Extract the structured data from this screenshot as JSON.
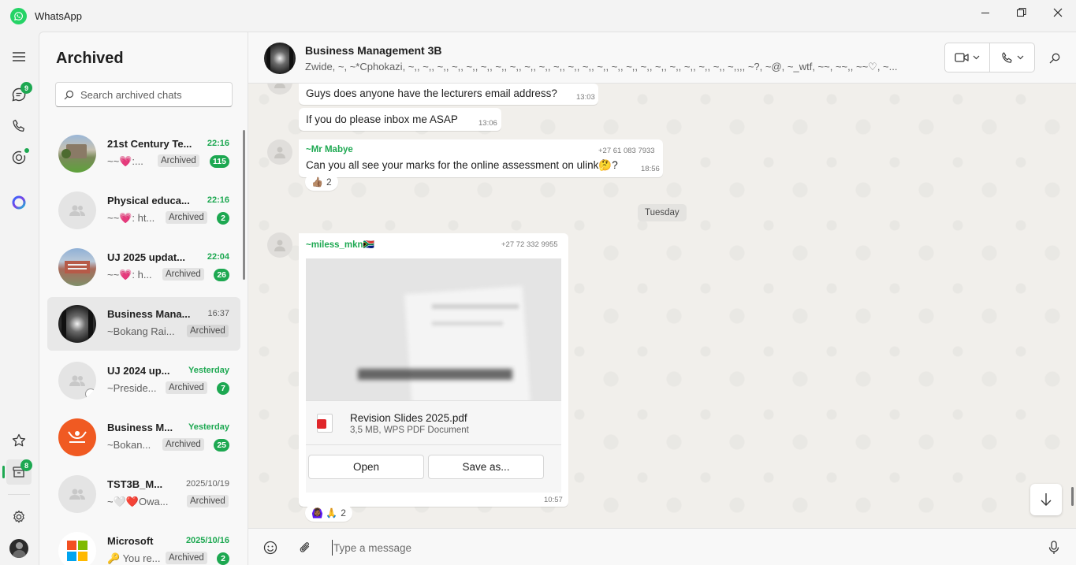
{
  "app": {
    "title": "WhatsApp"
  },
  "rail": {
    "chats_badge": "9",
    "archived_badge": "8"
  },
  "list": {
    "title": "Archived",
    "search_placeholder": "Search archived chats",
    "archived_label": "Archived",
    "chats": [
      {
        "name": "21st Century Te...",
        "time": "22:16",
        "preview": "~~💗:...",
        "count": "115",
        "unread": true,
        "avatar": "photo-campus"
      },
      {
        "name": "Physical educa...",
        "time": "22:16",
        "preview": "~~💗: ht...",
        "count": "2",
        "unread": true,
        "avatar": "group"
      },
      {
        "name": "UJ 2025 updat...",
        "time": "22:04",
        "preview": "~~💗: h...",
        "count": "26",
        "unread": true,
        "avatar": "photo-building"
      },
      {
        "name": "Business Mana...",
        "time": "16:37",
        "preview": "~Bokang Rai...",
        "count": "",
        "unread": false,
        "avatar": "photo-dark"
      },
      {
        "name": "UJ 2024 up...",
        "time": "Yesterday",
        "preview": "~Preside...",
        "count": "7",
        "unread": true,
        "avatar": "group"
      },
      {
        "name": "Business M...",
        "time": "Yesterday",
        "preview": "~Bokan...",
        "count": "25",
        "unread": true,
        "avatar": "logo-orange"
      },
      {
        "name": "TST3B_M...",
        "time": "2025/10/19",
        "preview": "~🤍❤️Owa...",
        "count": "",
        "unread": false,
        "avatar": "group"
      },
      {
        "name": "Microsoft",
        "time": "2025/10/16",
        "preview": "🔑 You re...",
        "count": "2",
        "unread": true,
        "avatar": "logo-microsoft"
      }
    ]
  },
  "conversation": {
    "name": "Business Management 3B",
    "members": "Zwide, ~, ~*Cphokazi, ~,, ~,, ~,, ~,, ~,, ~,, ~,, ~,, ~,, ~,, ~,, ~,, ~,, ~,, ~,, ~,, ~,, ~,, ~,, ~,, ~,, ~,, ~,,,, ~?, ~@, ~_wtf, ~~, ~~,, ~~♡, ~...",
    "messages": {
      "m1_text": "Guys does anyone have the lecturers email address?",
      "m1_time": "13:03",
      "m2_text": "If you do please inbox me ASAP",
      "m2_time": "13:06",
      "m3_sender": "~Mr Mabye",
      "m3_phone": "+27 61 083 7933",
      "m3_text": "Can you all see your marks for the online assessment on ulink🤔?",
      "m3_time": "18:56",
      "m3_reaction": "👍🏽",
      "m3_reaction_count": "2",
      "date_divider": "Tuesday",
      "m4_sender": "~miless_mkn🇿🇦",
      "m4_phone": "+27 72 332 9955",
      "m4_file_name": "Revision Slides 2025.pdf",
      "m4_file_meta": "3,5 MB, WPS PDF Document",
      "m4_open": "Open",
      "m4_save": "Save as...",
      "m4_time": "10:57",
      "m4_reactions": "🙆🏾‍♀️ 🙏",
      "m4_reaction_count": "2"
    },
    "composer_placeholder": "Type a message"
  }
}
